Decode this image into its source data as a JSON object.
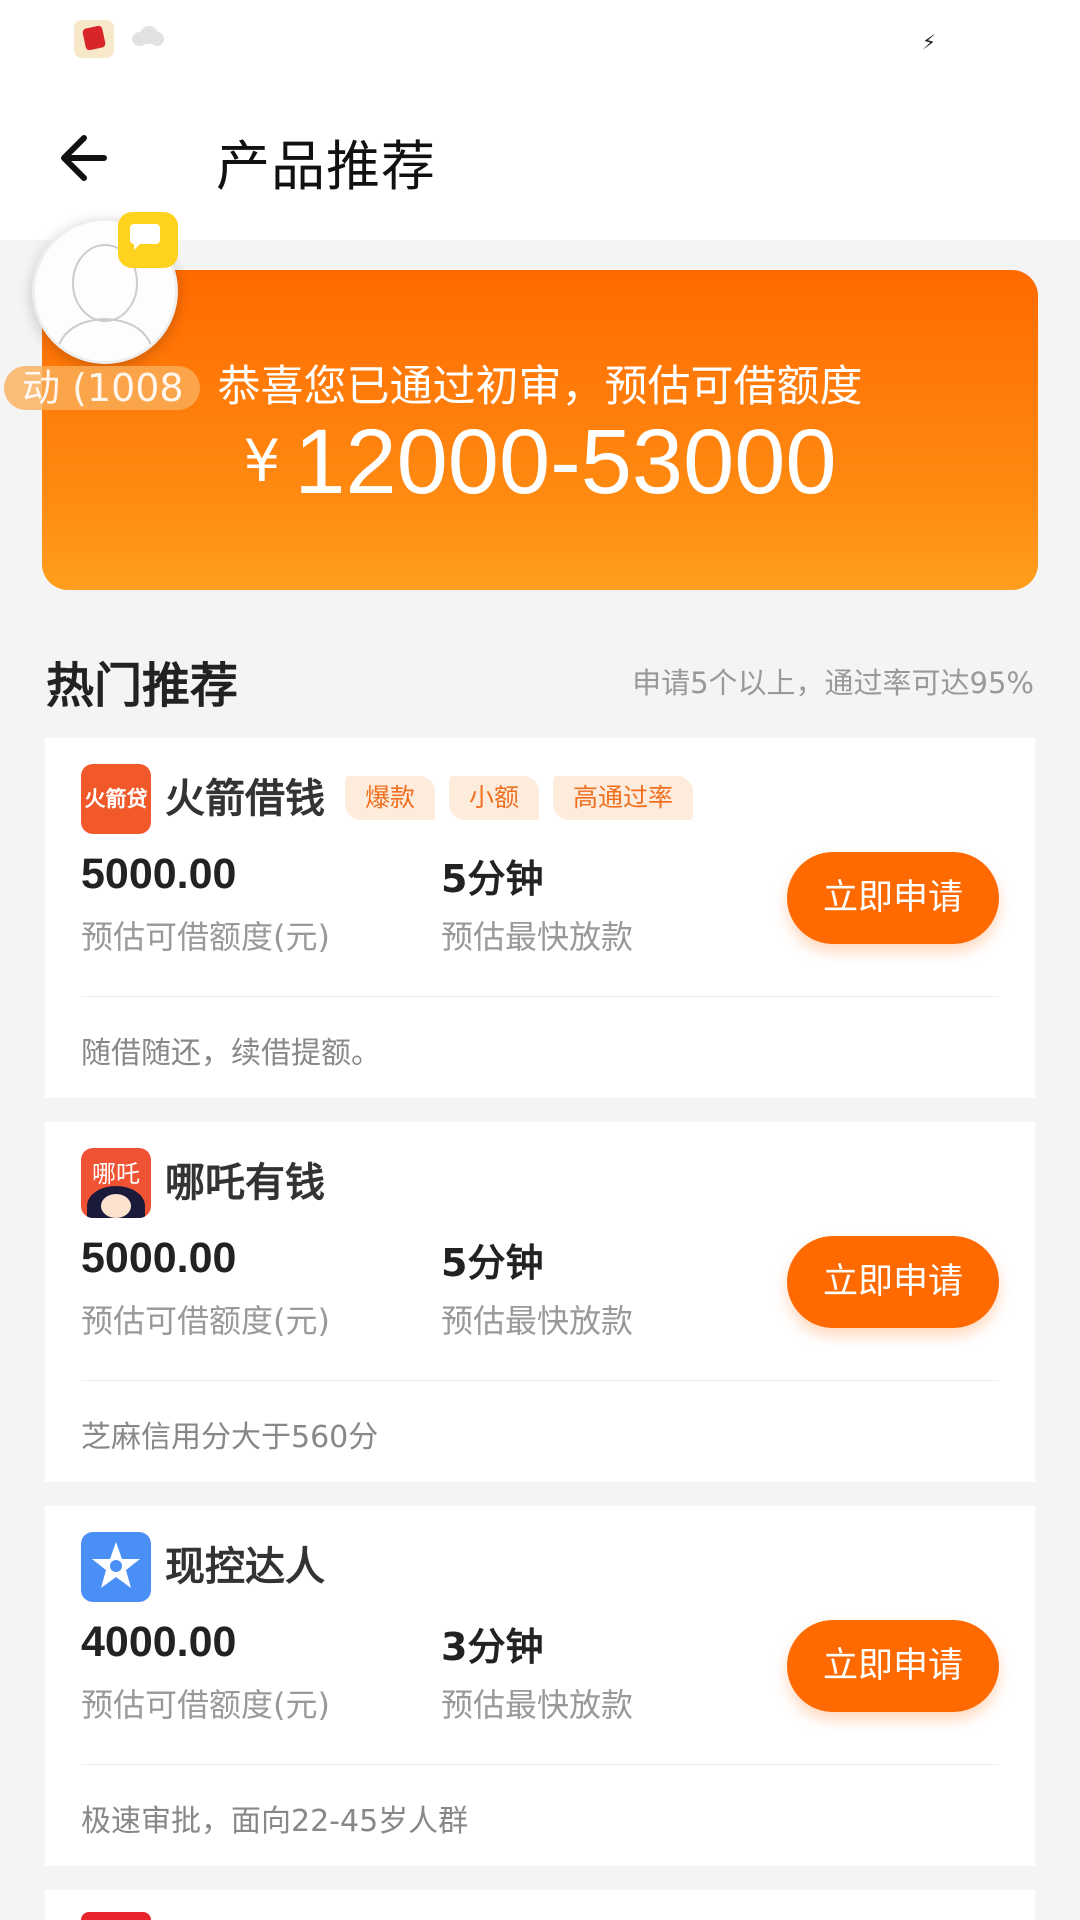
{
  "header": {
    "title": "产品推荐"
  },
  "float_widget": {
    "label": "动 (1008"
  },
  "hero": {
    "message": "恭喜您已通过初审，预估可借额度",
    "currency": "¥",
    "amount_range": "12000-53000"
  },
  "section": {
    "title": "热门推荐",
    "subtitle": "申请5个以上，通过率可达95%"
  },
  "products": [
    {
      "name": "火箭借钱",
      "logo_text": "火箭贷",
      "tags": [
        "爆款",
        "小额",
        "高通过率"
      ],
      "amount": "5000.00",
      "amount_label": "预估可借额度(元)",
      "speed": "5分钟",
      "speed_label": "预估最快放款",
      "apply_label": "立即申请",
      "description": "随借随还，续借提额。"
    },
    {
      "name": "哪吒有钱",
      "logo_text": "哪吒",
      "tags": [],
      "amount": "5000.00",
      "amount_label": "预估可借额度(元)",
      "speed": "5分钟",
      "speed_label": "预估最快放款",
      "apply_label": "立即申请",
      "description": "芝麻信用分大于560分"
    },
    {
      "name": "现控达人",
      "logo_text": "",
      "tags": [],
      "amount": "4000.00",
      "amount_label": "预估可借额度(元)",
      "speed": "3分钟",
      "speed_label": "预估最快放款",
      "apply_label": "立即申请",
      "description": "极速审批，面向22-45岁人群"
    }
  ],
  "colors": {
    "accent": "#ff6a00",
    "tag_bg": "#fdebdc",
    "tag_text": "#f07020"
  },
  "icons": {
    "back": "arrow-left-icon",
    "chat": "chat-bubble-icon"
  }
}
